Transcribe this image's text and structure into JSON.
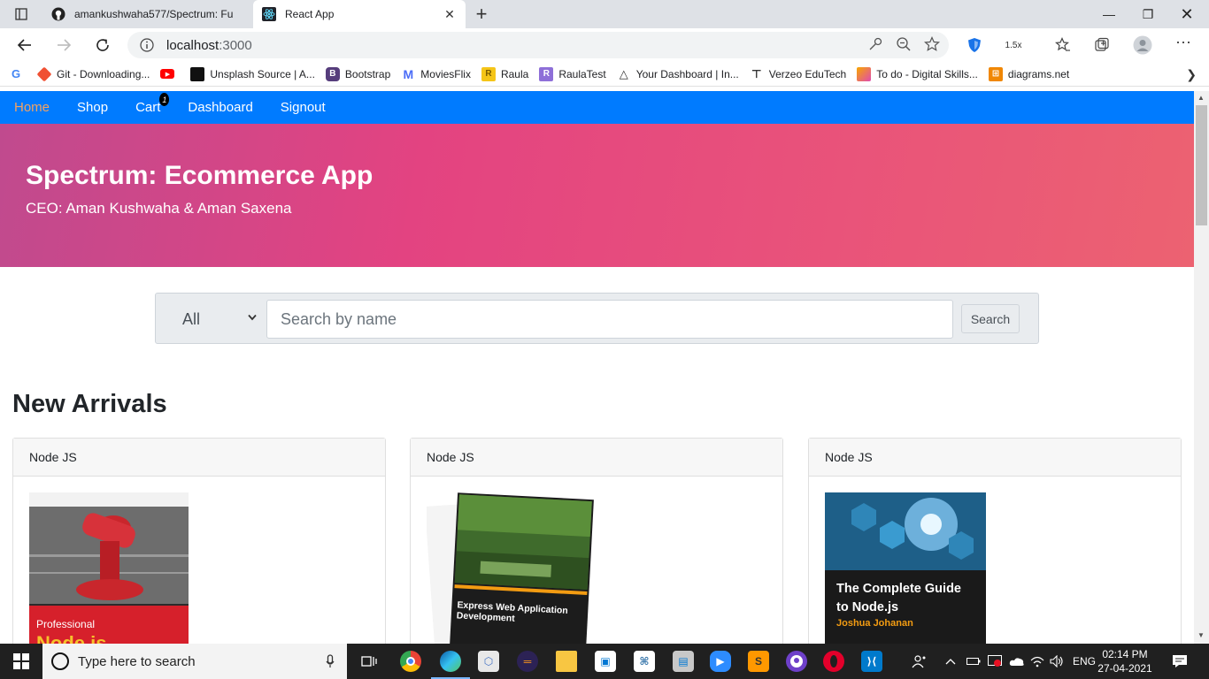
{
  "browser": {
    "tabs": [
      {
        "title": "amankushwaha577/Spectrum: Fu",
        "icon": "github-icon",
        "active": false
      },
      {
        "title": "React App",
        "icon": "react-icon",
        "active": true
      }
    ],
    "address": {
      "host": "localhost",
      "port": ":3000"
    },
    "zoom_label": "1.5x",
    "bookmarks": [
      {
        "label": "Git - Downloading...",
        "icon": "git-icon",
        "color": "#f05033"
      },
      {
        "label": "Unsplash Source | A...",
        "icon": "unsplash-icon",
        "color": "#111111"
      },
      {
        "label": "Bootstrap",
        "icon": "bootstrap-icon",
        "color": "#563d7c"
      },
      {
        "label": "MoviesFlix",
        "icon": "moviesflix-icon",
        "color": "#4a6cf7"
      },
      {
        "label": "Raula",
        "icon": "raula-icon",
        "color": "#f5c518"
      },
      {
        "label": "RaulaTest",
        "icon": "raulatest-icon",
        "color": "#8e6fd8"
      },
      {
        "label": "Your Dashboard | In...",
        "icon": "dashboard-icon",
        "color": "#333333"
      },
      {
        "label": "Verzeo EduTech",
        "icon": "verzeo-icon",
        "color": "#333333"
      },
      {
        "label": "To do - Digital Skills...",
        "icon": "todo-icon",
        "color": "#e04bb0"
      },
      {
        "label": "diagrams.net",
        "icon": "diagrams-icon",
        "color": "#f08705"
      }
    ]
  },
  "app": {
    "nav": [
      {
        "label": "Home",
        "active": true
      },
      {
        "label": "Shop",
        "active": false
      },
      {
        "label": "Cart",
        "active": false,
        "badge": "1"
      },
      {
        "label": "Dashboard",
        "active": false
      },
      {
        "label": "Signout",
        "active": false
      }
    ],
    "hero": {
      "title": "Spectrum: Ecommerce App",
      "subtitle": "CEO: Aman Kushwaha & Aman Saxena"
    },
    "search": {
      "category_selected": "All",
      "placeholder": "Search by name",
      "button_label": "Search"
    },
    "section_title": "New Arrivals",
    "products": [
      {
        "category": "Node JS",
        "cover_text_1": "Professional",
        "cover_text_2": "Node.js"
      },
      {
        "category": "Node JS",
        "cover_text_1": "Express Web Application",
        "cover_text_2": "Development"
      },
      {
        "category": "Node JS",
        "cover_text_1": "The Complete Guide",
        "cover_text_2": "to Node.js",
        "cover_text_3": "Joshua Johanan"
      }
    ]
  },
  "taskbar": {
    "search_placeholder": "Type here to search",
    "language": "ENG",
    "time": "02:14 PM",
    "date": "27-04-2021"
  }
}
